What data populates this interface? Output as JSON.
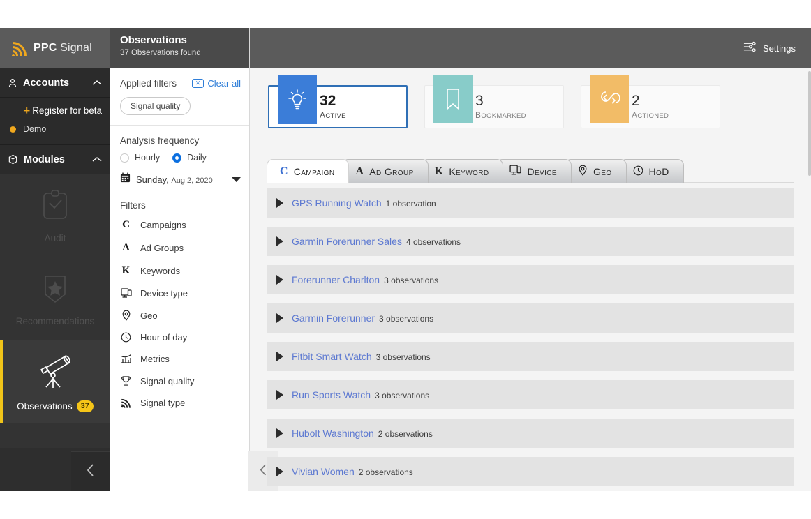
{
  "brand": {
    "name_bold": "PPC",
    "name_light": "Signal",
    "logo_icon": "rss-signal-icon"
  },
  "sidebar": {
    "accounts": {
      "label": "Accounts",
      "icon": "person-icon",
      "chevron": "chevron-up-icon",
      "register_label": "Register for beta",
      "register_plus": "+",
      "account_name": "Demo"
    },
    "modules": {
      "label": "Modules",
      "icon": "cube-icon",
      "chevron": "chevron-up-icon",
      "items": [
        {
          "label": "Audit",
          "icon": "clipboard-check-icon",
          "state": "disabled",
          "badge": ""
        },
        {
          "label": "Recommendations",
          "icon": "star-bookmark-icon",
          "state": "disabled",
          "badge": ""
        },
        {
          "label": "Observations",
          "icon": "telescope-icon",
          "state": "active",
          "badge": "37"
        }
      ]
    },
    "collapse_icon": "chevron-left-icon"
  },
  "filters_panel": {
    "title": "Observations",
    "subtitle": "37 Observations found",
    "applied_filters_label": "Applied filters",
    "clear_all_label": "Clear all",
    "clear_icon": "clear-x-icon",
    "chips": [
      "Signal quality"
    ],
    "analysis_frequency_label": "Analysis frequency",
    "frequency_options": [
      {
        "label": "Hourly",
        "selected": false
      },
      {
        "label": "Daily",
        "selected": true
      }
    ],
    "date_icon": "calendar-icon",
    "date_day": "Sunday,",
    "date_value": "Aug 2, 2020",
    "date_caret": "caret-down-icon",
    "filters_label": "Filters",
    "filter_items": [
      {
        "label": "Campaigns",
        "icon": "campaign-c-icon",
        "glyph": "C"
      },
      {
        "label": "Ad Groups",
        "icon": "adgroup-a-icon",
        "glyph": "A"
      },
      {
        "label": "Keywords",
        "icon": "keyword-k-icon",
        "glyph": "K"
      },
      {
        "label": "Device type",
        "icon": "device-icon",
        "glyph": ""
      },
      {
        "label": "Geo",
        "icon": "map-pin-icon",
        "glyph": ""
      },
      {
        "label": "Hour of day",
        "icon": "clock-icon",
        "glyph": ""
      },
      {
        "label": "Metrics",
        "icon": "bar-chart-icon",
        "glyph": ""
      },
      {
        "label": "Signal quality",
        "icon": "trophy-icon",
        "glyph": ""
      },
      {
        "label": "Signal type",
        "icon": "rss-signal-icon",
        "glyph": ""
      }
    ],
    "collapse_icon": "chevron-left-icon"
  },
  "topbar": {
    "settings_label": "Settings",
    "settings_icon": "sliders-icon"
  },
  "status_cards": [
    {
      "count": "32",
      "caption": "Active",
      "caption_small": "CTIVE",
      "caption_cap": "A",
      "icon": "lightbulb-icon",
      "color": "#3b7dd8",
      "selected": true
    },
    {
      "count": "3",
      "caption": "Bookmarked",
      "caption_small": "OOKMARKED",
      "caption_cap": "B",
      "icon": "bookmark-icon",
      "color": "#88ccc9",
      "selected": false
    },
    {
      "count": "2",
      "caption": "Actioned",
      "caption_small": "CTIONED",
      "caption_cap": "A",
      "icon": "action-loop-icon",
      "color": "#f2bc67",
      "selected": false
    }
  ],
  "tabs": [
    {
      "label": "Campaign",
      "icon": "campaign-c-icon",
      "glyph": "C",
      "active": true
    },
    {
      "label": "Ad Group",
      "icon": "adgroup-a-icon",
      "glyph": "A",
      "active": false
    },
    {
      "label": "Keyword",
      "icon": "keyword-k-icon",
      "glyph": "K",
      "active": false
    },
    {
      "label": "Device",
      "icon": "device-icon",
      "glyph": "",
      "active": false
    },
    {
      "label": "Geo",
      "icon": "map-pin-icon",
      "glyph": "",
      "active": false
    },
    {
      "label": "HoD",
      "icon": "clock-icon",
      "glyph": "",
      "active": false
    }
  ],
  "observation_rows": [
    {
      "name": "GPS Running Watch",
      "count": "1 observation",
      "expand_icon": "triangle-right-icon"
    },
    {
      "name": "Garmin Forerunner Sales",
      "count": "4 observations",
      "expand_icon": "triangle-right-icon"
    },
    {
      "name": "Forerunner Charlton",
      "count": "3 observations",
      "expand_icon": "triangle-right-icon"
    },
    {
      "name": "Garmin Forerunner",
      "count": "3 observations",
      "expand_icon": "triangle-right-icon"
    },
    {
      "name": "Fitbit Smart Watch",
      "count": "3 observations",
      "expand_icon": "triangle-right-icon"
    },
    {
      "name": "Run Sports Watch",
      "count": "3 observations",
      "expand_icon": "triangle-right-icon"
    },
    {
      "name": "Hubolt Washington",
      "count": "2 observations",
      "expand_icon": "triangle-right-icon"
    },
    {
      "name": "Vivian Women",
      "count": "2 observations",
      "expand_icon": "triangle-right-icon"
    }
  ],
  "colors": {
    "brand_orange": "#f0a81e",
    "accent_yellow": "#f5c518",
    "link_blue": "#5d79d1",
    "active_blue": "#3b7dd8",
    "teal": "#88ccc9",
    "orange": "#f2bc67",
    "sidebar_dark": "#2b2b2b",
    "header_gray": "#5b5b5b"
  }
}
